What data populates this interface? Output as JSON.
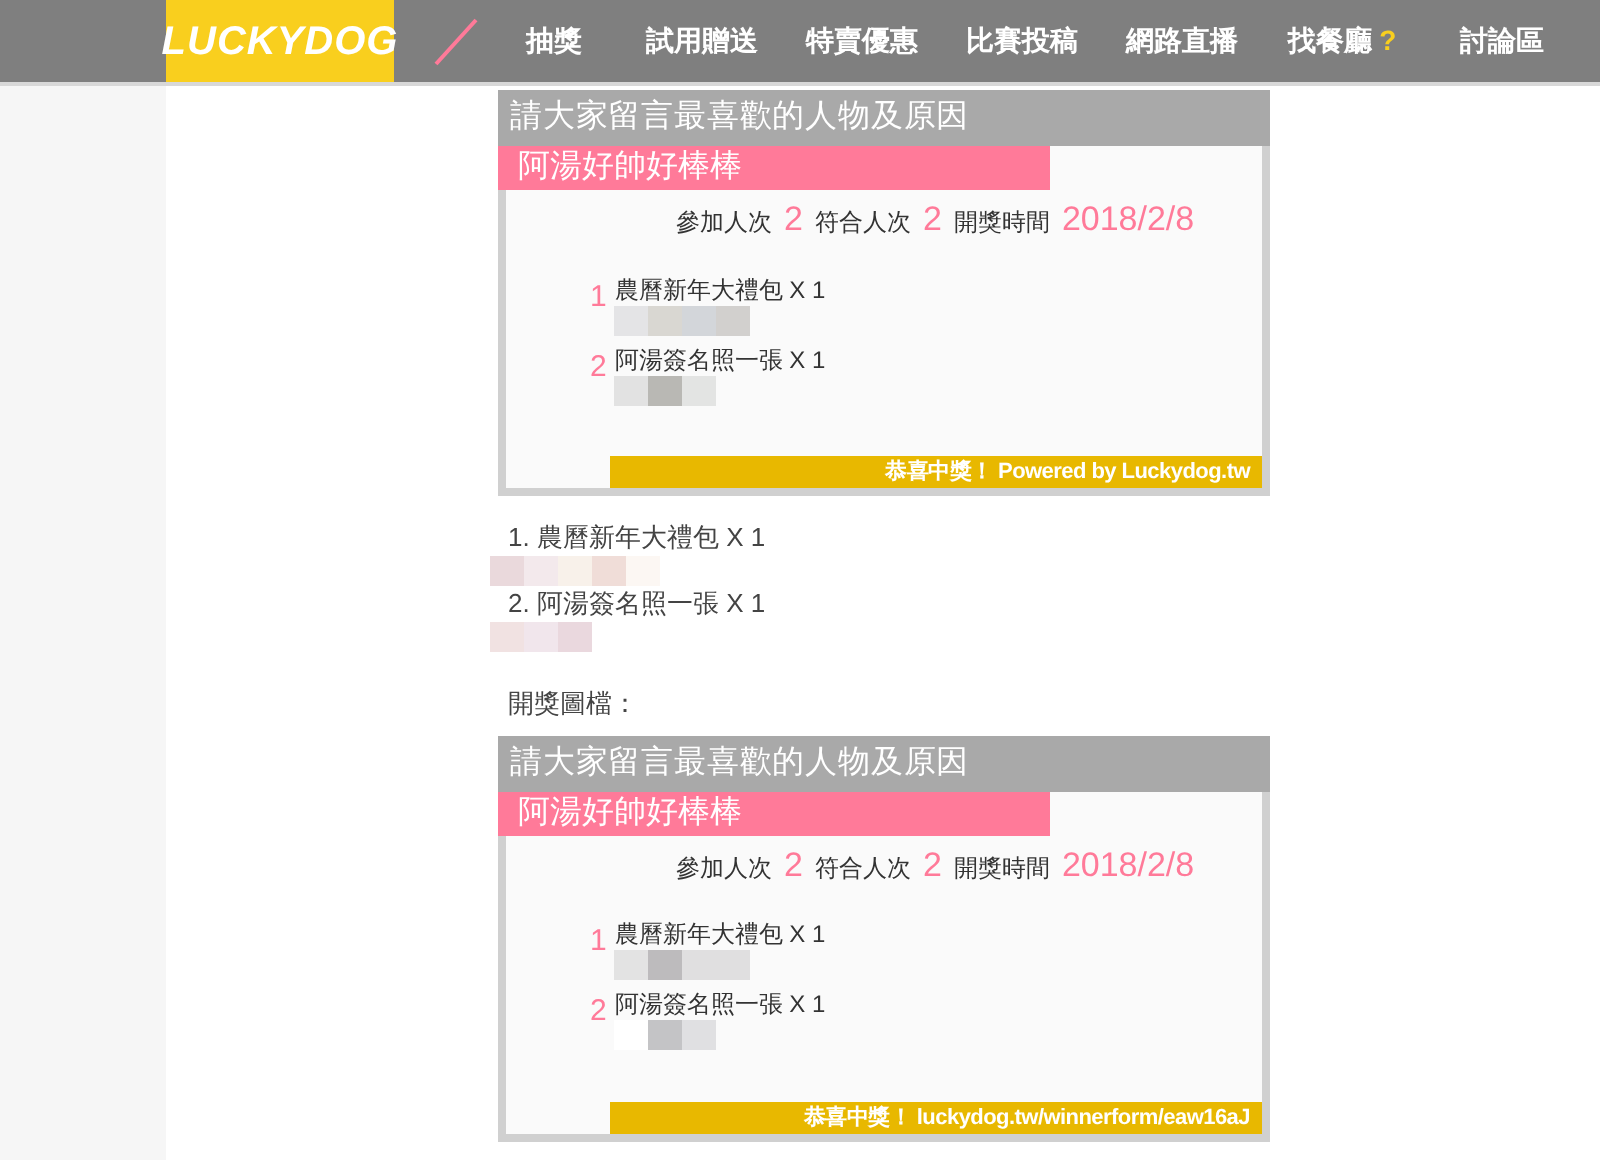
{
  "nav": {
    "logo": "LUCKYDOG",
    "items": [
      {
        "label": "抽獎"
      },
      {
        "label": "試用贈送"
      },
      {
        "label": "特賣優惠"
      },
      {
        "label": "比賽投稿"
      },
      {
        "label": "網路直播"
      },
      {
        "label": "找餐廳",
        "badge": "?"
      },
      {
        "label": "討論區"
      }
    ]
  },
  "cards": [
    {
      "header": "請大家留言最喜歡的人物及原因",
      "title": "阿湯好帥好棒棒",
      "stats": [
        {
          "label": "參加人次",
          "value": "2"
        },
        {
          "label": "符合人次",
          "value": "2"
        },
        {
          "label": "開獎時間",
          "value": "2018/2/8"
        }
      ],
      "prizes": [
        {
          "index": "1",
          "name": "農曆新年大禮包 X 1"
        },
        {
          "index": "2",
          "name": "阿湯簽名照一張 X 1"
        }
      ],
      "footer": "恭喜中獎！ Powered by Luckydog.tw"
    }
  ],
  "winners": [
    "1. 農曆新年大禮包 X 1",
    "2. 阿湯簽名照一張 X 1"
  ],
  "image_label": "開獎圖檔：",
  "image_card": {
    "header": "請大家留言最喜歡的人物及原因",
    "title": "阿湯好帥好棒棒",
    "stats": [
      {
        "label": "參加人次",
        "value": "2"
      },
      {
        "label": "符合人次",
        "value": "2"
      },
      {
        "label": "開獎時間",
        "value": "2018/2/8"
      }
    ],
    "prizes": [
      {
        "index": "1",
        "name": "農曆新年大禮包 X 1"
      },
      {
        "index": "2",
        "name": "阿湯簽名照一張 X 1"
      }
    ],
    "footer": "恭喜中獎！ luckydog.tw/winnerform/eaw16aJ"
  }
}
